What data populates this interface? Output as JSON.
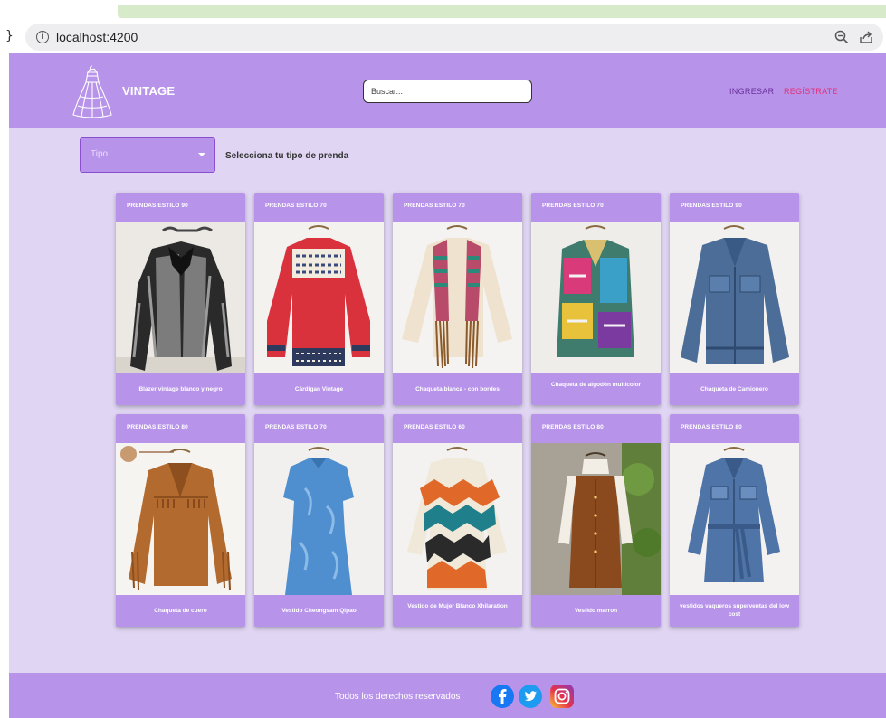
{
  "browser": {
    "url": "localhost:4200",
    "tab_glyph": "}"
  },
  "header": {
    "brand": "VINTAGE",
    "search_placeholder": "Buscar...",
    "login": "INGRESAR",
    "register": "REGÍSTRATE"
  },
  "filter": {
    "selected": "Tipo",
    "hint": "Selecciona tu tipo de prenda"
  },
  "products": [
    {
      "category": "PRENDAS ESTILO 90",
      "name": "Blazer vintage blanco y negro"
    },
    {
      "category": "PRENDAS ESTILO 70",
      "name": "Cárdigan Vintage"
    },
    {
      "category": "PRENDAS ESTILO 70",
      "name": "Chaqueta blanca - con bordes"
    },
    {
      "category": "PRENDAS ESTILO 70",
      "name": "Chaqueta de algodón multicolor"
    },
    {
      "category": "PRENDAS ESTILO 90",
      "name": "Chaqueta de Camionero"
    },
    {
      "category": "PRENDAS ESTILO 80",
      "name": "Chaqueta de cuero"
    },
    {
      "category": "PRENDAS ESTILO 70",
      "name": "Vestido Cheongsam Qipao"
    },
    {
      "category": "PRENDAS ESTILO 60",
      "name": "Vestido de Mujer Blanco Xhilaration"
    },
    {
      "category": "PRENDAS ESTILO 80",
      "name": "Vestido marron"
    },
    {
      "category": "PRENDAS ESTILO 80",
      "name": "vestidos vaqueros superventas del low cost"
    }
  ],
  "footer": {
    "text": "Todos los derechos reservados",
    "social": [
      "facebook-icon",
      "twitter-icon",
      "instagram-icon"
    ]
  },
  "colors": {
    "header": "#b794ea",
    "page_bg": "#e0d6f3",
    "card": "#b794ea",
    "register": "#e0317a",
    "login": "#6b2f9c"
  }
}
